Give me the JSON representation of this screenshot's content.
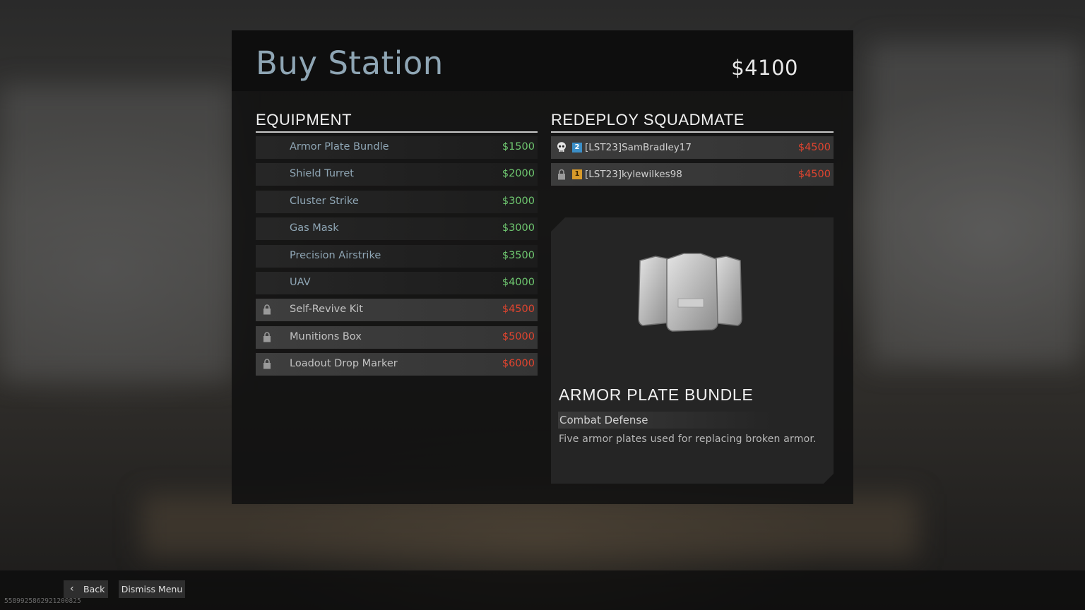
{
  "header": {
    "title": "Buy Station",
    "cash": "$4100"
  },
  "equipment": {
    "heading": "EQUIPMENT",
    "items": [
      {
        "name": "Armor Plate Bundle",
        "price": "$1500",
        "affordable": true
      },
      {
        "name": "Shield Turret",
        "price": "$2000",
        "affordable": true
      },
      {
        "name": "Cluster Strike",
        "price": "$3000",
        "affordable": true
      },
      {
        "name": "Gas Mask",
        "price": "$3000",
        "affordable": true
      },
      {
        "name": "Precision Airstrike",
        "price": "$3500",
        "affordable": true
      },
      {
        "name": "UAV",
        "price": "$4000",
        "affordable": true
      },
      {
        "name": "Self-Revive Kit",
        "price": "$4500",
        "affordable": false
      },
      {
        "name": "Munitions Box",
        "price": "$5000",
        "affordable": false
      },
      {
        "name": "Loadout Drop Marker",
        "price": "$6000",
        "affordable": false
      }
    ]
  },
  "redeploy": {
    "heading": "REDEPLOY SQUADMATE",
    "squadmates": [
      {
        "slot": "2",
        "name": "[LST23]SamBradley17",
        "price": "$4500",
        "status_icon": "skull-icon",
        "badge_color": "#3b8fc8"
      },
      {
        "slot": "1",
        "name": "[LST23]kylewilkes98",
        "price": "$4500",
        "status_icon": "lock-icon",
        "badge_color": "#d89a2a"
      }
    ]
  },
  "detail": {
    "title": "ARMOR PLATE BUNDLE",
    "category": "Combat Defense",
    "description": "Five armor plates used for replacing broken armor.",
    "image_icon": "armor-plates-icon"
  },
  "footer": {
    "back_label": "Back",
    "dismiss_label": "Dismiss Menu",
    "build_id": "5589925862921200825"
  },
  "colors": {
    "affordable": "#6fc870",
    "unaffordable": "#e0442f",
    "title": "#8fa6b5"
  }
}
